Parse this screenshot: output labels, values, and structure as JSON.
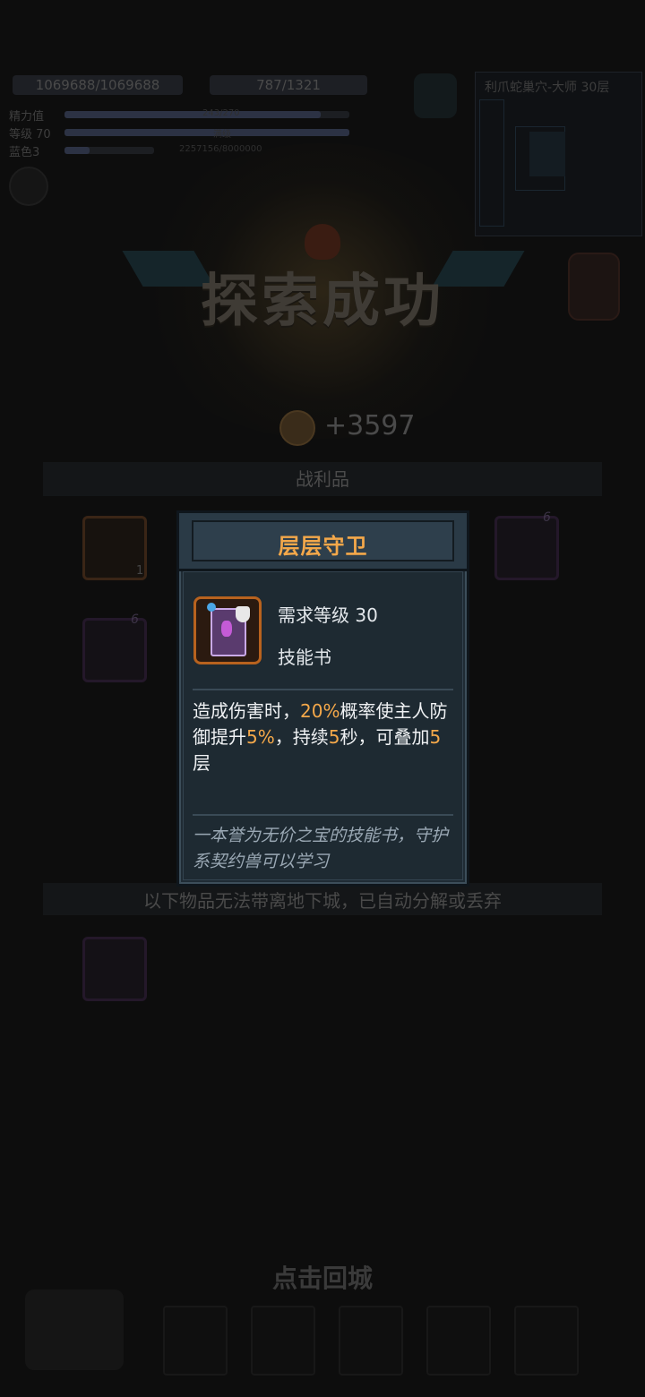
{
  "hud": {
    "hp": "1069688/1069688",
    "mp": "787/1321",
    "stats": [
      {
        "label": "精力值",
        "value": "243/270"
      },
      {
        "label": "等级 70",
        "value": "满级"
      },
      {
        "label": "蓝色3",
        "value": "2257156/8000000"
      }
    ]
  },
  "minimap": {
    "title": "利爪蛇巢穴-大师 30层"
  },
  "result": {
    "banner": "探索成功",
    "gold": "+3597",
    "loot_header": "战利品",
    "slot_count": "1",
    "slot_level": "6",
    "note": "以下物品无法带离地下城，已自动分解或丢弃",
    "return_button": "点击回城"
  },
  "popup": {
    "title": "层层守卫",
    "required_level": "需求等级 30",
    "item_type": "技能书",
    "desc_parts": [
      "造成伤害时，",
      "20%",
      "概率使主人防御提升",
      "5%",
      "，持续",
      "5",
      "秒，可叠加",
      "5",
      "层"
    ],
    "flavor": "一本誉为无价之宝的技能书，守护系契约兽可以学习"
  },
  "colors": {
    "accent": "#f4a84a",
    "popup_bg": "#1f2b34",
    "rarity_orange": "#b8621e"
  }
}
